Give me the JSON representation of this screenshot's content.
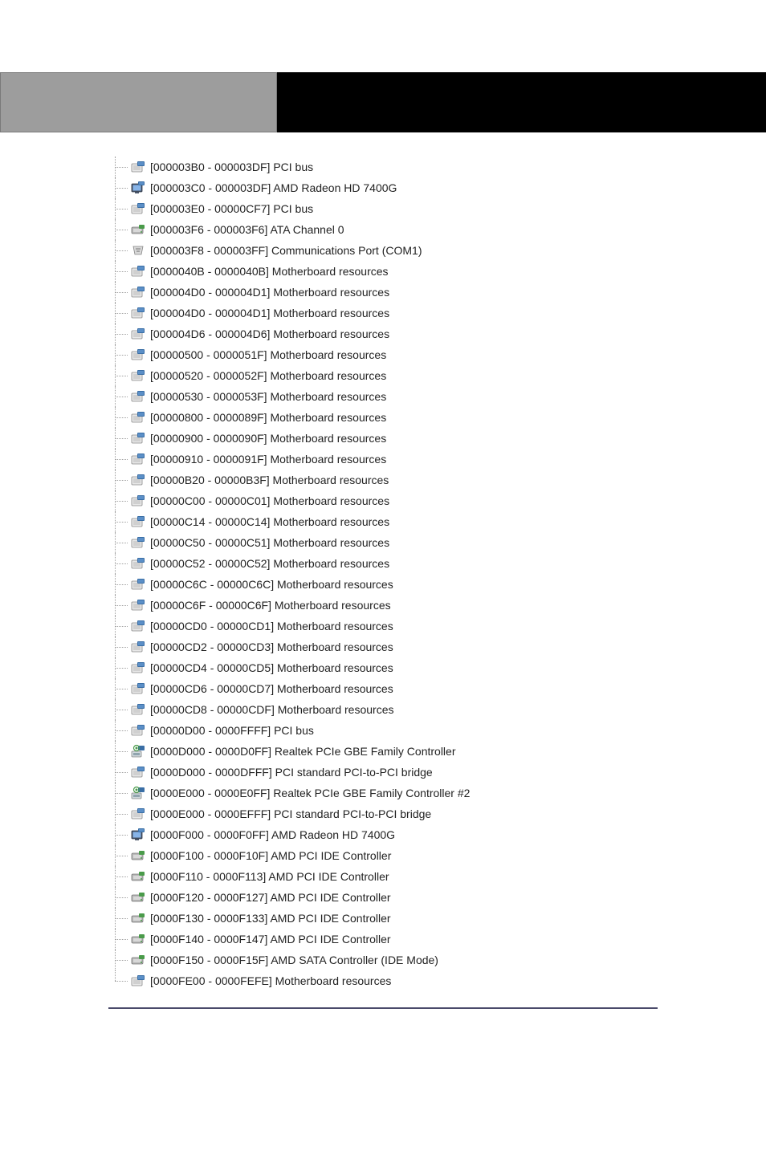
{
  "header": {
    "left_label": "",
    "right_label": ""
  },
  "tree": {
    "items": [
      {
        "icon": "system-device-icon",
        "range": "[000003B0 - 000003DF]",
        "name": "PCI bus"
      },
      {
        "icon": "display-adapter-icon",
        "range": "[000003C0 - 000003DF]",
        "name": "AMD Radeon HD 7400G"
      },
      {
        "icon": "system-device-icon",
        "range": "[000003E0 - 00000CF7]",
        "name": "PCI bus"
      },
      {
        "icon": "ide-channel-icon",
        "range": "[000003F6 - 000003F6]",
        "name": "ATA Channel 0"
      },
      {
        "icon": "com-port-icon",
        "range": "[000003F8 - 000003FF]",
        "name": "Communications Port (COM1)"
      },
      {
        "icon": "system-device-icon",
        "range": "[0000040B - 0000040B]",
        "name": "Motherboard resources"
      },
      {
        "icon": "system-device-icon",
        "range": "[000004D0 - 000004D1]",
        "name": "Motherboard resources"
      },
      {
        "icon": "system-device-icon",
        "range": "[000004D0 - 000004D1]",
        "name": "Motherboard resources"
      },
      {
        "icon": "system-device-icon",
        "range": "[000004D6 - 000004D6]",
        "name": "Motherboard resources"
      },
      {
        "icon": "system-device-icon",
        "range": "[00000500 - 0000051F]",
        "name": "Motherboard resources"
      },
      {
        "icon": "system-device-icon",
        "range": "[00000520 - 0000052F]",
        "name": "Motherboard resources"
      },
      {
        "icon": "system-device-icon",
        "range": "[00000530 - 0000053F]",
        "name": "Motherboard resources"
      },
      {
        "icon": "system-device-icon",
        "range": "[00000800 - 0000089F]",
        "name": "Motherboard resources"
      },
      {
        "icon": "system-device-icon",
        "range": "[00000900 - 0000090F]",
        "name": "Motherboard resources"
      },
      {
        "icon": "system-device-icon",
        "range": "[00000910 - 0000091F]",
        "name": "Motherboard resources"
      },
      {
        "icon": "system-device-icon",
        "range": "[00000B20 - 00000B3F]",
        "name": "Motherboard resources"
      },
      {
        "icon": "system-device-icon",
        "range": "[00000C00 - 00000C01]",
        "name": "Motherboard resources"
      },
      {
        "icon": "system-device-icon",
        "range": "[00000C14 - 00000C14]",
        "name": "Motherboard resources"
      },
      {
        "icon": "system-device-icon",
        "range": "[00000C50 - 00000C51]",
        "name": "Motherboard resources"
      },
      {
        "icon": "system-device-icon",
        "range": "[00000C52 - 00000C52]",
        "name": "Motherboard resources"
      },
      {
        "icon": "system-device-icon",
        "range": "[00000C6C - 00000C6C]",
        "name": "Motherboard resources"
      },
      {
        "icon": "system-device-icon",
        "range": "[00000C6F - 00000C6F]",
        "name": "Motherboard resources"
      },
      {
        "icon": "system-device-icon",
        "range": "[00000CD0 - 00000CD1]",
        "name": "Motherboard resources"
      },
      {
        "icon": "system-device-icon",
        "range": "[00000CD2 - 00000CD3]",
        "name": "Motherboard resources"
      },
      {
        "icon": "system-device-icon",
        "range": "[00000CD4 - 00000CD5]",
        "name": "Motherboard resources"
      },
      {
        "icon": "system-device-icon",
        "range": "[00000CD6 - 00000CD7]",
        "name": "Motherboard resources"
      },
      {
        "icon": "system-device-icon",
        "range": "[00000CD8 - 00000CDF]",
        "name": "Motherboard resources"
      },
      {
        "icon": "system-device-icon",
        "range": "[00000D00 - 0000FFFF]",
        "name": "PCI bus"
      },
      {
        "icon": "network-adapter-icon",
        "range": "[0000D000 - 0000D0FF]",
        "name": "Realtek PCIe GBE Family Controller"
      },
      {
        "icon": "system-device-icon",
        "range": "[0000D000 - 0000DFFF]",
        "name": "PCI standard PCI-to-PCI bridge"
      },
      {
        "icon": "network-adapter-icon",
        "range": "[0000E000 - 0000E0FF]",
        "name": "Realtek PCIe GBE Family Controller #2"
      },
      {
        "icon": "system-device-icon",
        "range": "[0000E000 - 0000EFFF]",
        "name": "PCI standard PCI-to-PCI bridge"
      },
      {
        "icon": "display-adapter-icon",
        "range": "[0000F000 - 0000F0FF]",
        "name": "AMD Radeon HD 7400G"
      },
      {
        "icon": "ide-channel-icon",
        "range": "[0000F100 - 0000F10F]",
        "name": "AMD PCI IDE Controller"
      },
      {
        "icon": "ide-channel-icon",
        "range": "[0000F110 - 0000F113]",
        "name": "AMD PCI IDE Controller"
      },
      {
        "icon": "ide-channel-icon",
        "range": "[0000F120 - 0000F127]",
        "name": "AMD PCI IDE Controller"
      },
      {
        "icon": "ide-channel-icon",
        "range": "[0000F130 - 0000F133]",
        "name": "AMD PCI IDE Controller"
      },
      {
        "icon": "ide-channel-icon",
        "range": "[0000F140 - 0000F147]",
        "name": "AMD PCI IDE Controller"
      },
      {
        "icon": "ide-channel-icon",
        "range": "[0000F150 - 0000F15F]",
        "name": "AMD SATA Controller (IDE Mode)"
      },
      {
        "icon": "system-device-icon",
        "range": "[0000FE00 - 0000FEFE]",
        "name": "Motherboard resources"
      }
    ]
  }
}
